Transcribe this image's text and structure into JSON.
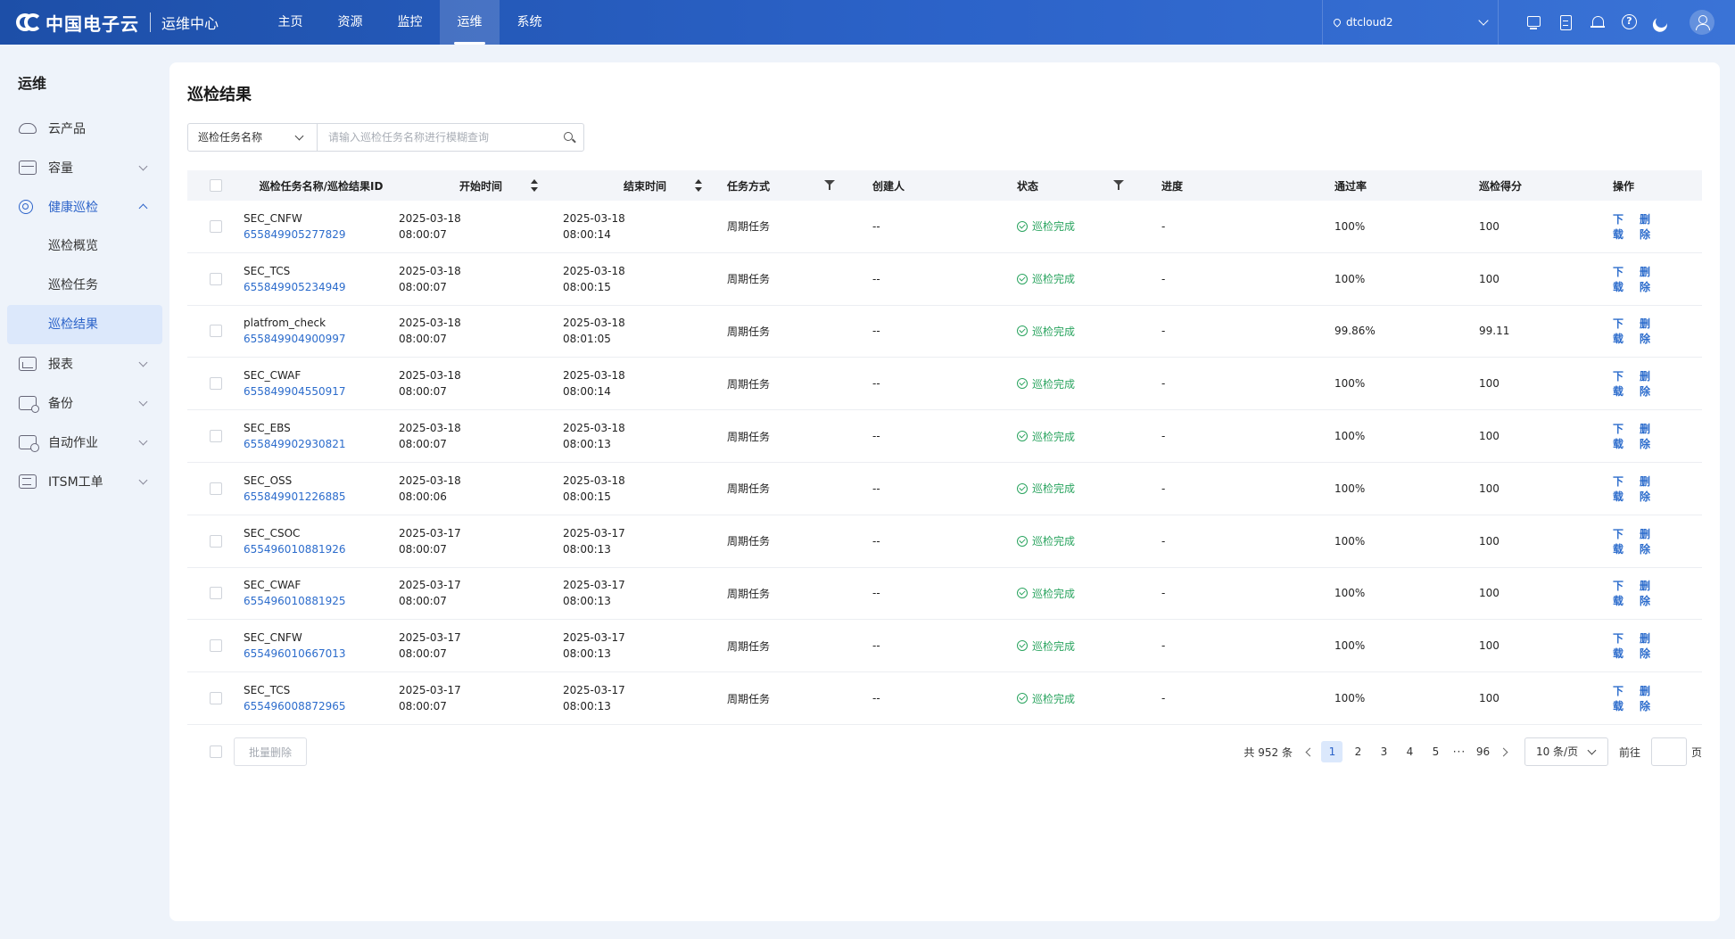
{
  "header": {
    "brand": "中国电子云",
    "subtitle": "运维中心",
    "nav": [
      {
        "label": "主页",
        "active": false
      },
      {
        "label": "资源",
        "active": false
      },
      {
        "label": "监控",
        "active": false
      },
      {
        "label": "运维",
        "active": true
      },
      {
        "label": "系统",
        "active": false
      }
    ],
    "tenant": "dtcloud2",
    "icons": [
      "monitor-icon",
      "document-icon",
      "bell-icon",
      "help-icon",
      "moon-icon",
      "user-avatar-icon"
    ]
  },
  "sidebar": {
    "title": "运维",
    "items": [
      {
        "label": "云产品",
        "icon": "cloud-icon",
        "expandable": false
      },
      {
        "label": "容量",
        "icon": "box-icon",
        "expandable": true
      },
      {
        "label": "健康巡检",
        "icon": "target-icon",
        "expandable": true,
        "open": true,
        "children": [
          "巡检概览",
          "巡检任务",
          "巡检结果"
        ],
        "active_child": "巡检结果"
      },
      {
        "label": "报表",
        "icon": "chart-icon",
        "expandable": true
      },
      {
        "label": "备份",
        "icon": "backup-icon",
        "expandable": true
      },
      {
        "label": "自动作业",
        "icon": "automation-icon",
        "expandable": true
      },
      {
        "label": "ITSM工单",
        "icon": "ticket-icon",
        "expandable": true
      }
    ]
  },
  "main": {
    "title": "巡检结果",
    "search": {
      "field": "巡检任务名称",
      "placeholder": "请输入巡检任务名称进行模糊查询",
      "value": ""
    },
    "columns": {
      "name": "巡检任务名称/巡检结果ID",
      "start": "开始时间",
      "end": "结束时间",
      "mode": "任务方式",
      "creator": "创建人",
      "status": "状态",
      "progress": "进度",
      "pass_rate": "通过率",
      "score": "巡检得分",
      "ops": "操作"
    },
    "rows": [
      {
        "name": "SEC_CNFW",
        "id": "655849905277829",
        "start_date": "2025-03-18",
        "start_time": "08:00:07",
        "end_date": "2025-03-18",
        "end_time": "08:00:14",
        "mode": "周期任务",
        "creator": "--",
        "status": "巡检完成",
        "progress": "-",
        "pass_rate": "100%",
        "score": "100"
      },
      {
        "name": "SEC_TCS",
        "id": "655849905234949",
        "start_date": "2025-03-18",
        "start_time": "08:00:07",
        "end_date": "2025-03-18",
        "end_time": "08:00:15",
        "mode": "周期任务",
        "creator": "--",
        "status": "巡检完成",
        "progress": "-",
        "pass_rate": "100%",
        "score": "100"
      },
      {
        "name": "platfrom_check",
        "id": "655849904900997",
        "start_date": "2025-03-18",
        "start_time": "08:00:07",
        "end_date": "2025-03-18",
        "end_time": "08:01:05",
        "mode": "周期任务",
        "creator": "--",
        "status": "巡检完成",
        "progress": "-",
        "pass_rate": "99.86%",
        "score": "99.11"
      },
      {
        "name": "SEC_CWAF",
        "id": "655849904550917",
        "start_date": "2025-03-18",
        "start_time": "08:00:07",
        "end_date": "2025-03-18",
        "end_time": "08:00:14",
        "mode": "周期任务",
        "creator": "--",
        "status": "巡检完成",
        "progress": "-",
        "pass_rate": "100%",
        "score": "100"
      },
      {
        "name": "SEC_EBS",
        "id": "655849902930821",
        "start_date": "2025-03-18",
        "start_time": "08:00:07",
        "end_date": "2025-03-18",
        "end_time": "08:00:13",
        "mode": "周期任务",
        "creator": "--",
        "status": "巡检完成",
        "progress": "-",
        "pass_rate": "100%",
        "score": "100"
      },
      {
        "name": "SEC_OSS",
        "id": "655849901226885",
        "start_date": "2025-03-18",
        "start_time": "08:00:06",
        "end_date": "2025-03-18",
        "end_time": "08:00:15",
        "mode": "周期任务",
        "creator": "--",
        "status": "巡检完成",
        "progress": "-",
        "pass_rate": "100%",
        "score": "100"
      },
      {
        "name": "SEC_CSOC",
        "id": "655496010881926",
        "start_date": "2025-03-17",
        "start_time": "08:00:07",
        "end_date": "2025-03-17",
        "end_time": "08:00:13",
        "mode": "周期任务",
        "creator": "--",
        "status": "巡检完成",
        "progress": "-",
        "pass_rate": "100%",
        "score": "100"
      },
      {
        "name": "SEC_CWAF",
        "id": "655496010881925",
        "start_date": "2025-03-17",
        "start_time": "08:00:07",
        "end_date": "2025-03-17",
        "end_time": "08:00:13",
        "mode": "周期任务",
        "creator": "--",
        "status": "巡检完成",
        "progress": "-",
        "pass_rate": "100%",
        "score": "100"
      },
      {
        "name": "SEC_CNFW",
        "id": "655496010667013",
        "start_date": "2025-03-17",
        "start_time": "08:00:07",
        "end_date": "2025-03-17",
        "end_time": "08:00:13",
        "mode": "周期任务",
        "creator": "--",
        "status": "巡检完成",
        "progress": "-",
        "pass_rate": "100%",
        "score": "100"
      },
      {
        "name": "SEC_TCS",
        "id": "655496008872965",
        "start_date": "2025-03-17",
        "start_time": "08:00:07",
        "end_date": "2025-03-17",
        "end_time": "08:00:13",
        "mode": "周期任务",
        "creator": "--",
        "status": "巡检完成",
        "progress": "-",
        "pass_rate": "100%",
        "score": "100"
      }
    ],
    "row_ops": {
      "download": "下载",
      "delete": "删除"
    },
    "batch_delete": "批量删除",
    "pagination": {
      "total": "共 952 条",
      "pages": [
        "1",
        "2",
        "3",
        "4",
        "5"
      ],
      "current": "1",
      "ellipsis": "···",
      "last": "96",
      "page_size": "10 条/页",
      "goto_label": "前往",
      "goto_value": "",
      "goto_suffix": "页"
    },
    "colors": {
      "header_bg": "#2c63c9",
      "accent": "#2c6ccc",
      "success": "#2aa45f",
      "active_menu_bg": "#dce8fb"
    }
  }
}
